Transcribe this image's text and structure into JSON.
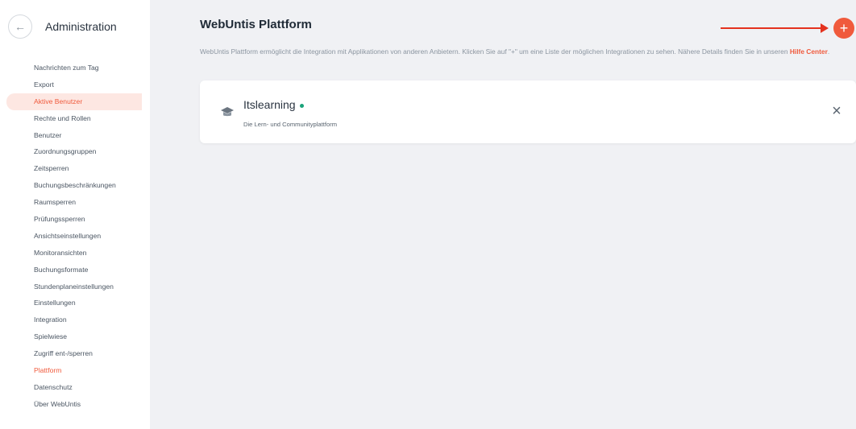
{
  "sidebar": {
    "title": "Administration",
    "items": [
      {
        "label": "Nachrichten zum Tag",
        "state": ""
      },
      {
        "label": "Export",
        "state": ""
      },
      {
        "label": "Aktive Benutzer",
        "state": "active"
      },
      {
        "label": "Rechte und Rollen",
        "state": ""
      },
      {
        "label": "Benutzer",
        "state": ""
      },
      {
        "label": "Zuordnungsgruppen",
        "state": ""
      },
      {
        "label": "Zeitsperren",
        "state": ""
      },
      {
        "label": "Buchungsbeschränkungen",
        "state": ""
      },
      {
        "label": "Raumsperren",
        "state": ""
      },
      {
        "label": "Prüfungssperren",
        "state": ""
      },
      {
        "label": "Ansichtseinstellungen",
        "state": ""
      },
      {
        "label": "Monitoransichten",
        "state": ""
      },
      {
        "label": "Buchungsformate",
        "state": ""
      },
      {
        "label": "Stundenplaneinstellungen",
        "state": ""
      },
      {
        "label": "Einstellungen",
        "state": ""
      },
      {
        "label": "Integration",
        "state": ""
      },
      {
        "label": "Spielwiese",
        "state": ""
      },
      {
        "label": "Zugriff ent-/sperren",
        "state": ""
      },
      {
        "label": "Plattform",
        "state": "current"
      },
      {
        "label": "Datenschutz",
        "state": ""
      },
      {
        "label": "Über WebUntis",
        "state": ""
      }
    ]
  },
  "main": {
    "title": "WebUntis Plattform",
    "description": "WebUntis Plattform ermöglicht die Integration mit Applikationen von anderen Anbietern. Klicken Sie auf \"+\" um eine Liste der möglichen Integrationen zu sehen. Nähere Details finden Sie in unseren ",
    "help_link": "Hilfe Center",
    "description_end": ".",
    "add_label": "+",
    "integrations": [
      {
        "name": "Itslearning",
        "subtitle": "Die Lern- und Communityplattform",
        "icon": "graduation-cap-icon",
        "status_color": "#1aa37a"
      }
    ]
  },
  "colors": {
    "accent": "#f05a3c",
    "arrow": "#e4321e",
    "status_active": "#1aa37a"
  }
}
